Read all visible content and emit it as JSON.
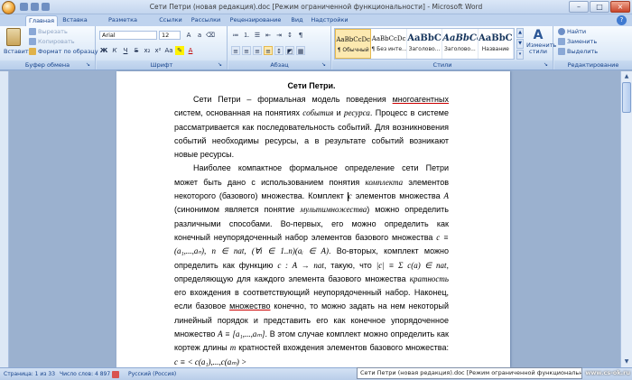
{
  "window": {
    "title": "Сети Петри (новая редакция).doc [Режим ограниченной функциональности] - Microsoft Word",
    "minimize": "–",
    "maximize": "□",
    "close": "×"
  },
  "tabs": [
    "Главная",
    "Вставка",
    "Разметка страницы",
    "Ссылки",
    "Рассылки",
    "Рецензирование",
    "Вид",
    "Надстройки"
  ],
  "ribbon": {
    "clipboard": {
      "label": "Буфер обмена",
      "paste": "Вставить",
      "cut": "Вырезать",
      "copy": "Копировать",
      "format_painter": "Формат по образцу"
    },
    "font": {
      "label": "Шрифт",
      "font_name": "Arial",
      "font_size": "12"
    },
    "paragraph": {
      "label": "Абзац"
    },
    "styles": {
      "label": "Стили",
      "items": [
        {
          "preview": "AaBbCcDc",
          "name": "¶ Обычный"
        },
        {
          "preview": "AaBbCcDc",
          "name": "¶ Без инте..."
        },
        {
          "preview": "AaBbC",
          "name": "Заголово..."
        },
        {
          "preview": "AaBbCc",
          "name": "Заголово..."
        },
        {
          "preview": "AaBbC",
          "name": "Название"
        }
      ],
      "change_styles": "Изменить стили"
    },
    "editing": {
      "label": "Редактирование",
      "find": "Найти",
      "replace": "Заменить",
      "select": "Выделить"
    }
  },
  "document": {
    "title": "Сети Петри.",
    "p1": {
      "a": "Сети Петри – формальная модель поведения ",
      "u1": "многоагентных",
      "b": " систем, основанная на понятиях ",
      "i1": "события",
      "c": " и ",
      "i2": "ресурса",
      "d": ". Процесс в системе рассматривается как последовательность событий. Для возникновения событий необходимы ресурсы, а в результате событий возникают новые ресурсы."
    },
    "p2": {
      "a": "Наиболее компактное формальное определение сети Петри может быть дано с использованием понятия ",
      "i1": "комплекта",
      "b": " элементов некоторого (базового) множества. Комплект ",
      "m1": "c",
      "c": " элементов множества ",
      "m2": "A",
      "d": " (синонимом является понятие ",
      "i2": "мультимножества",
      "e": ") можно определить различными способами. Во-первых, его можно определить как конечный неупорядоченный набор элементов базового множества ",
      "f1": "c ≡ (a₁,...,aₙ),",
      "f2": "n ∈ nat,",
      "f3": "(∀i ∈ 1..n)(aᵢ ∈ A)",
      "f": ". Во-вторых, комплект можно определить как функцию ",
      "f4": "c : A → nat",
      "g": ", такую, что ",
      "f5": "|c| ≡ Σ c(a) ∈ nat",
      "h": ", определяющую для каждого элемента базового множества ",
      "i3": "кратность",
      "j": " его вхождения в соответствующий неупорядоченный набор. Наконец, если базовое ",
      "u1": "множество",
      "k": " конечно, то можно задать на нем некоторый линейный порядок и представить его как конечное упорядоченное множество ",
      "f6": "A ≡ [a₁,...,aₘ]",
      "l": ". В этом случае комплект можно определить как кортеж длины ",
      "m3": "m",
      "m": " кратностей вхождения элементов базового множества: ",
      "f7": "c ≡ < c(a₁),...,c(aₘ) >"
    }
  },
  "status": {
    "page": "Страница: 1 из 33",
    "words": "Число слов: 4 897",
    "language": "Русский (Россия)",
    "tooltip": "Сети Петри (новая редакция).doc [Режим ограниченной функциональности] - Microsoft Word",
    "watermark": "www.cs-ok.ru"
  }
}
